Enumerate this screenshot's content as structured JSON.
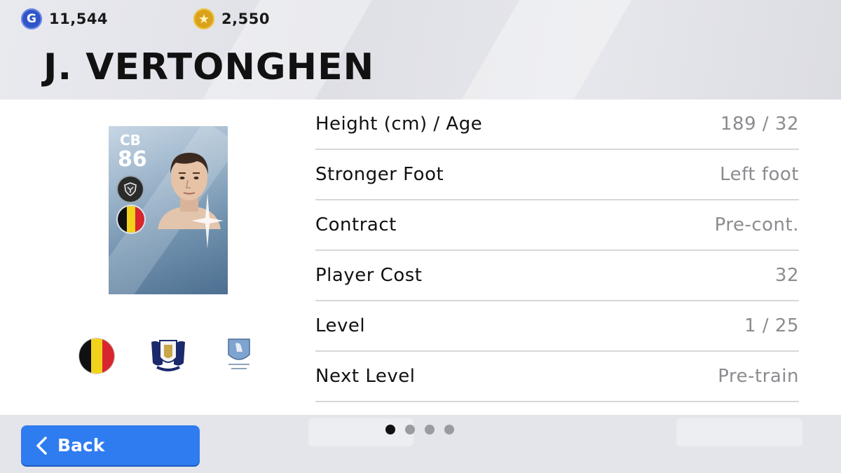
{
  "header": {
    "currencies": [
      {
        "icon": "gp-coin-icon",
        "symbol": "G",
        "value": "11,544"
      },
      {
        "icon": "star-coin-icon",
        "symbol": "★",
        "value": "2,550"
      }
    ],
    "player_name": "J. VERTONGHEN"
  },
  "card": {
    "position": "CB",
    "rating": "86",
    "nationality": "Belgium"
  },
  "details": [
    {
      "label": "Height (cm) / Age",
      "value": "189 / 32"
    },
    {
      "label": "Stronger Foot",
      "value": "Left foot"
    },
    {
      "label": "Contract",
      "value": "Pre-cont."
    },
    {
      "label": "Player Cost",
      "value": "32"
    },
    {
      "label": "Level",
      "value": "1 / 25"
    },
    {
      "label": "Next Level",
      "value": "Pre-train"
    }
  ],
  "footer": {
    "back_label": "Back",
    "pages": 4,
    "current_page": 1
  },
  "colors": {
    "accent": "#2f7cf0",
    "flag": [
      "#111111",
      "#f3d21b",
      "#d7262e"
    ]
  }
}
